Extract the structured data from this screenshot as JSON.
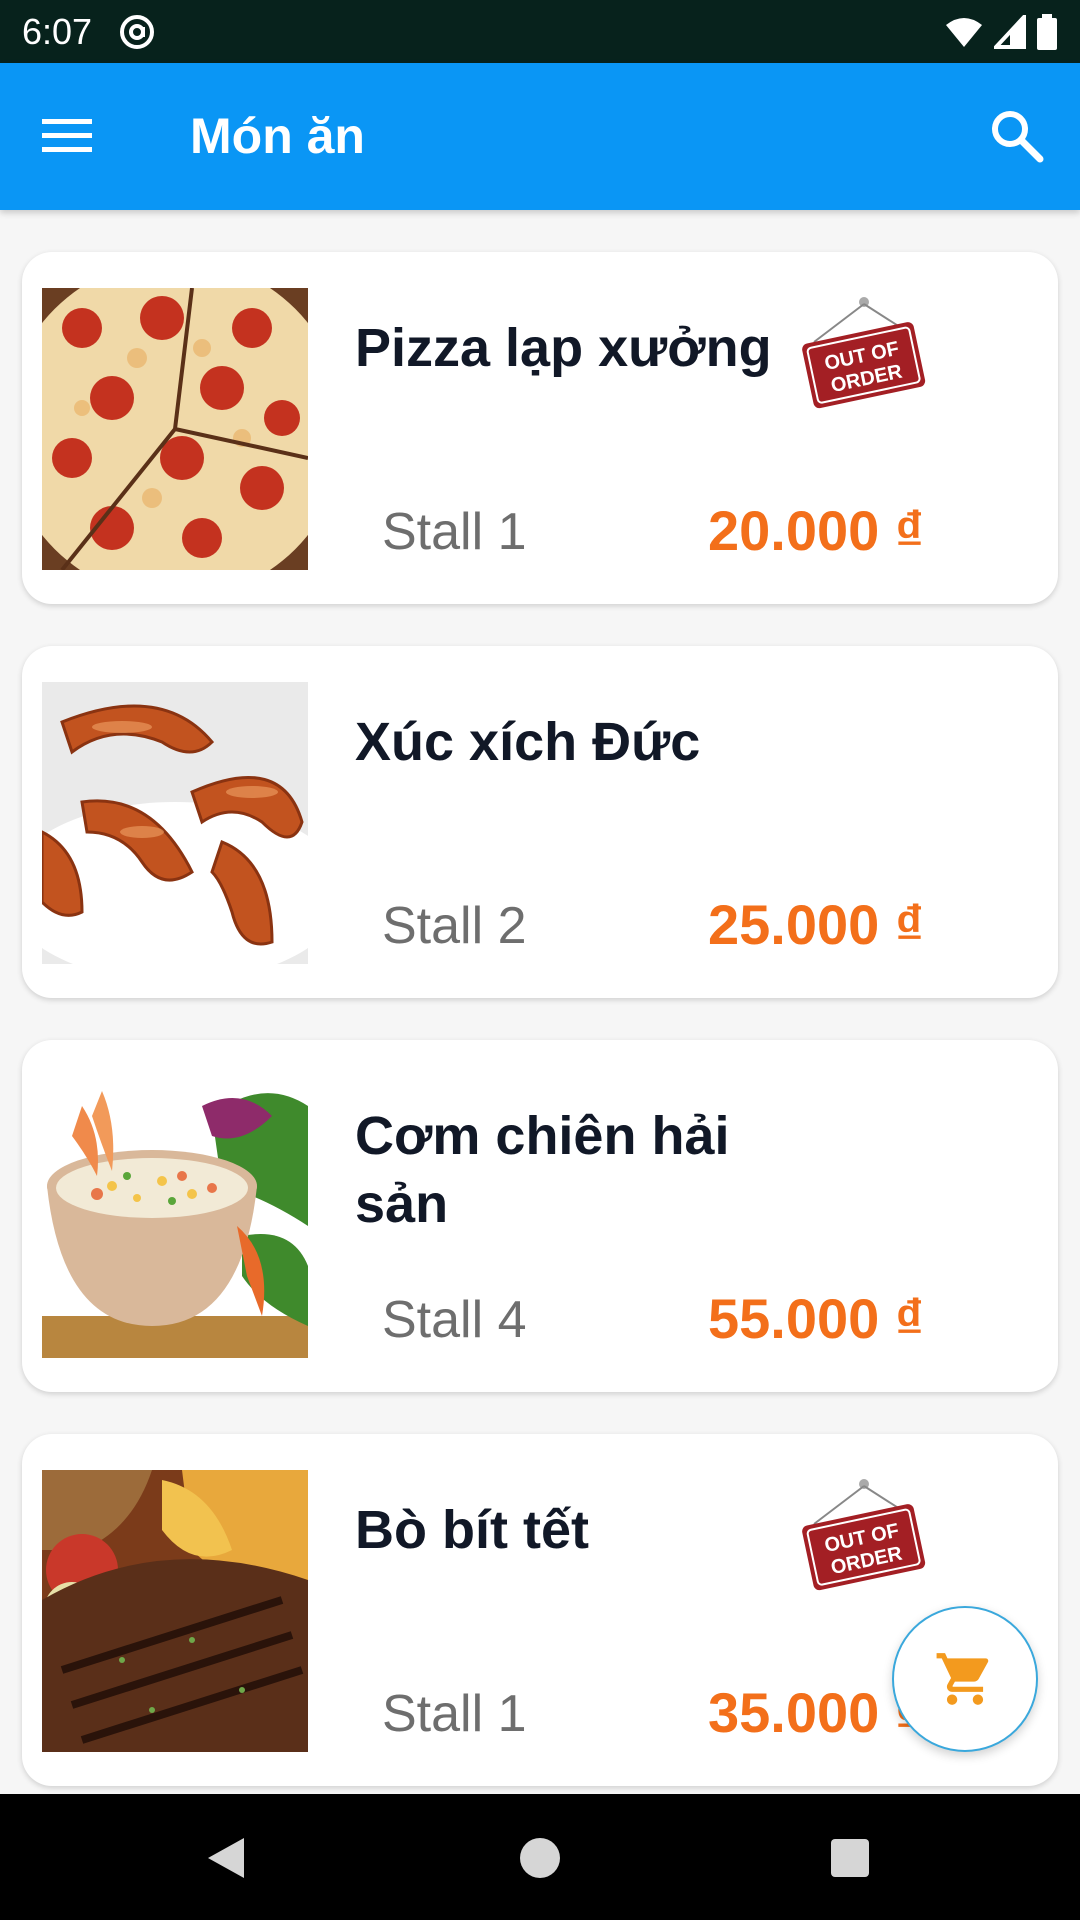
{
  "status_bar": {
    "time": "6:07"
  },
  "app_bar": {
    "title": "Món ăn"
  },
  "colors": {
    "primary": "#0a96f5",
    "price": "#f36f1a",
    "sign": "#a31f24"
  },
  "items": [
    {
      "name": "Pizza lạp xưởng",
      "stall": "Stall 1",
      "price": "20.000 ₫",
      "image": "pizza",
      "out_of_order": true,
      "sign_text": [
        "OUT OF",
        "ORDER"
      ]
    },
    {
      "name": "Xúc xích Đức",
      "stall": "Stall 2",
      "price": "25.000 ₫",
      "image": "sausage",
      "out_of_order": false
    },
    {
      "name": "Cơm chiên hải sản",
      "stall": "Stall 4",
      "price": "55.000 ₫",
      "image": "fried-rice",
      "out_of_order": false
    },
    {
      "name": "Bò bít tết",
      "stall": "Stall 1",
      "price": "35.000 ₫",
      "image": "steak",
      "out_of_order": true,
      "sign_text": [
        "OUT OF",
        "ORDER"
      ]
    }
  ],
  "fab": {
    "icon": "cart-icon"
  },
  "nav": {
    "back": "back-icon",
    "home": "home-icon",
    "recents": "recents-icon"
  }
}
